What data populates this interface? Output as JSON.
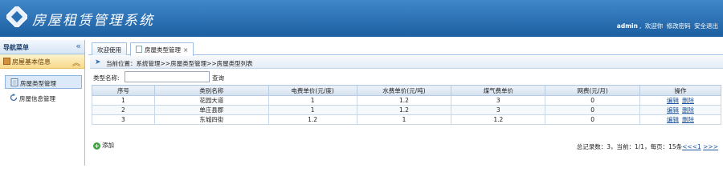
{
  "header": {
    "title": "房屋租赁管理系统",
    "username": "admin",
    "welcome": "欢迎你",
    "change_password": "修改密码",
    "logout": "安全退出"
  },
  "sidebar": {
    "title": "导航菜单",
    "group": "房屋基本信息",
    "items": [
      {
        "label": "房屋类型管理"
      },
      {
        "label": "房屋信息管理"
      }
    ]
  },
  "tabs": [
    {
      "label": "欢迎使用"
    },
    {
      "label": "房屋类型管理"
    }
  ],
  "breadcrumb": "当前位置：系统管理>>房屋类型管理>>房屋类型列表",
  "search": {
    "label": "类型名称:",
    "value": "",
    "button": "查询"
  },
  "table": {
    "columns": [
      "序号",
      "类别名称",
      "电费单价(元/度)",
      "水费单价(元/吨)",
      "煤气费单价",
      "网费(元/月)",
      "操作"
    ],
    "rows": [
      [
        "1",
        "花园大道",
        "1",
        "1.2",
        "3",
        "0"
      ],
      [
        "2",
        "单庄县郡",
        "1",
        "1.2",
        "3",
        "0"
      ],
      [
        "3",
        "东城四街",
        "1.2",
        "1",
        "1.2",
        "0"
      ]
    ],
    "edit_label": "编辑",
    "delete_label": "删除"
  },
  "add_label": "添加",
  "pager": {
    "text": "总记录数：3，当前：1/1，每页：15条",
    "prev": "<<<1",
    "next": ">>>"
  },
  "colors": {
    "header": "#2a6eb4",
    "accent": "#1b56a5",
    "group": "#f7d98b"
  }
}
